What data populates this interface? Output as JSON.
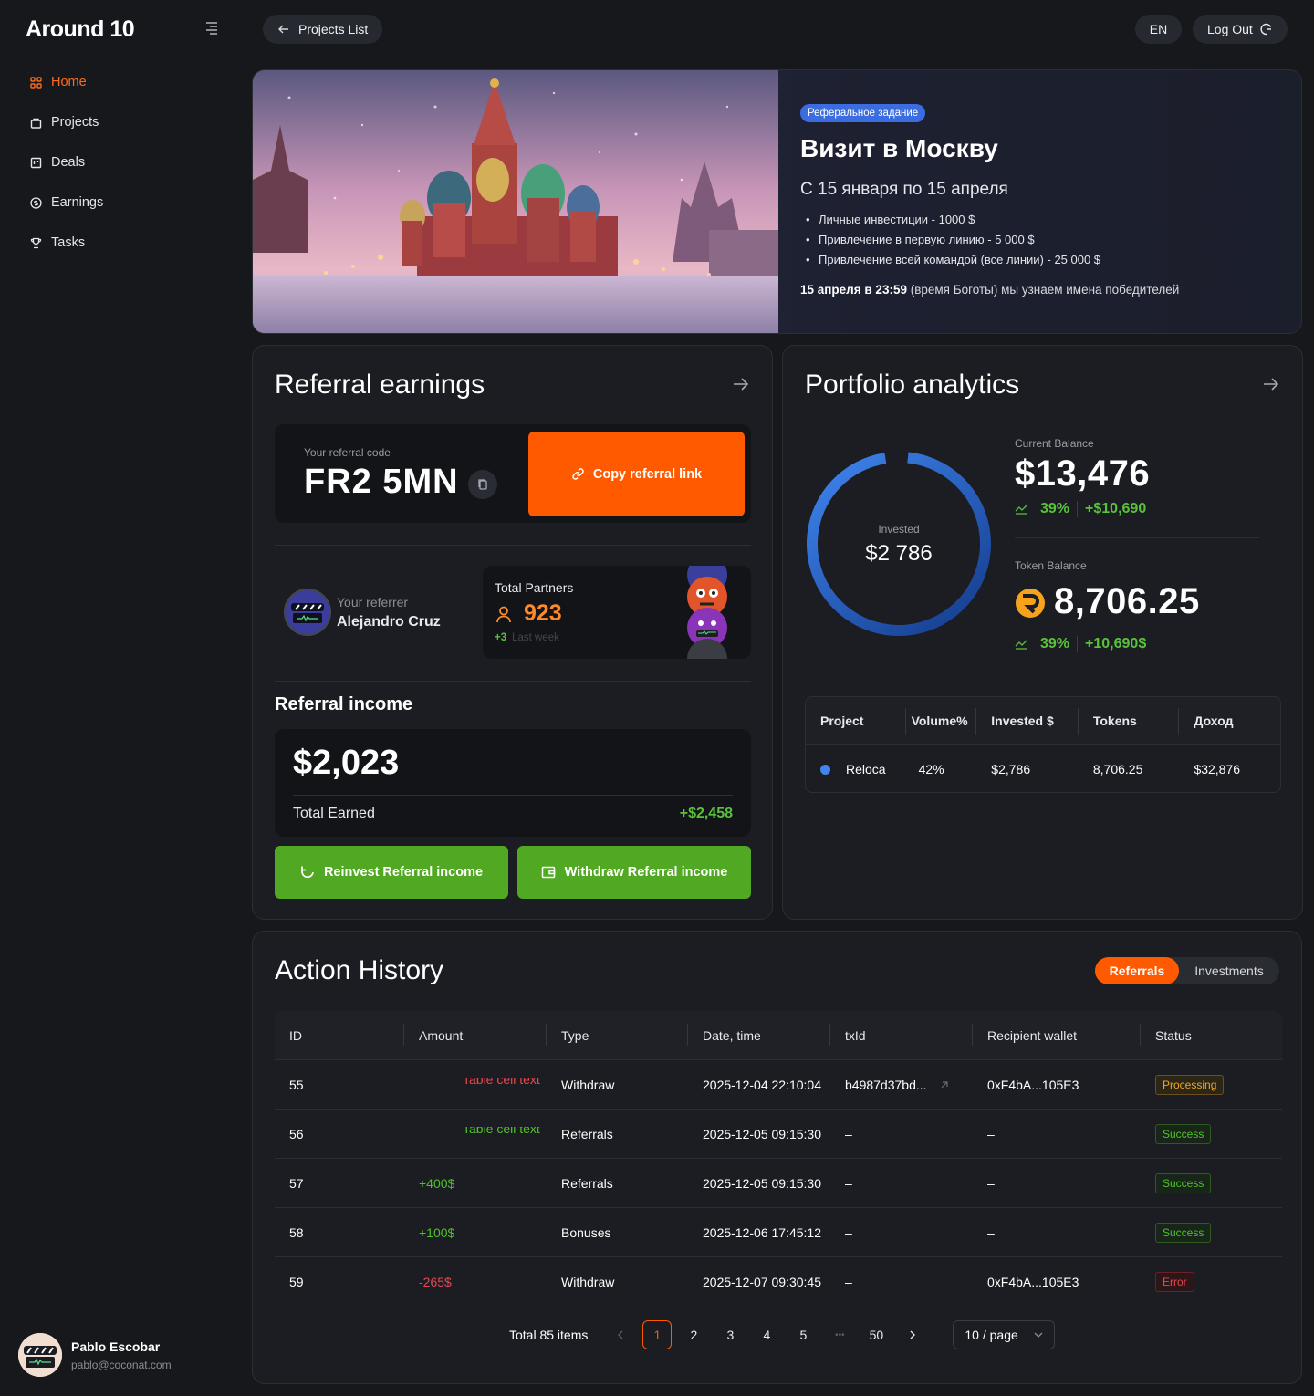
{
  "brand": {
    "logo": "Around 10"
  },
  "nav": [
    {
      "label": "Home",
      "icon": "grid-icon"
    },
    {
      "label": "Projects",
      "icon": "bag-icon"
    },
    {
      "label": "Deals",
      "icon": "board-icon"
    },
    {
      "label": "Earnings",
      "icon": "dollar-circle-icon"
    },
    {
      "label": "Tasks",
      "icon": "trophy-icon"
    }
  ],
  "user": {
    "name": "Pablo Escobar",
    "email": "pablo@coconat.com"
  },
  "topbar": {
    "back_label": "Projects List",
    "lang": "EN",
    "logout_label": "Log Out"
  },
  "banner": {
    "badge": "Реферальное задание",
    "title": "Визит в Москву",
    "subtitle": "С 15 января по 15 апреля",
    "items": [
      "Личные инвестиции - 1000 $",
      "Привлечение в первую линию - 5 000 $",
      "Привлечение всей командой (все линии) - 25 000 $"
    ],
    "note_bold": "15 апреля в 23:59",
    "note_rest": " (время Боготы) мы узнаем имена победителей"
  },
  "referral": {
    "title": "Referral earnings",
    "code_label": "Your referral code",
    "code": "FR2 5MN",
    "copy_link": "Copy referral link",
    "referrer_label": "Your referrer",
    "referrer_name": "Alejandro Cruz",
    "partners_label": "Total Partners",
    "partners_count": "923",
    "partners_delta": "+3",
    "partners_period": "Last week",
    "income_title": "Referral income",
    "income_value": "$2,023",
    "total_earned_label": "Total Earned",
    "total_earned_delta": "+$2,458",
    "reinvest_label": "Reinvest Referral income",
    "withdraw_label": "Withdraw Referral income"
  },
  "portfolio": {
    "title": "Portfolio analytics",
    "invested_label": "Invested",
    "invested_value": "$2 786",
    "current_balance_label": "Current Balance",
    "current_balance": "$13,476",
    "current_pct": "39%",
    "current_delta": "+$10,690",
    "token_balance_label": "Token Balance",
    "token_balance": "8,706.25",
    "token_pct": "39%",
    "token_delta": "+10,690$",
    "accent": "#2f6fe0",
    "table": {
      "headers": [
        "Project",
        "Volume%",
        "Invested $",
        "Tokens",
        "Доход"
      ],
      "rows": [
        [
          "Reloca",
          "42%",
          "$2,786",
          "8,706.25",
          "$32,876"
        ]
      ]
    }
  },
  "history": {
    "title": "Action History",
    "tabs": [
      "Referrals",
      "Investments"
    ],
    "headers": [
      "ID",
      "Amount",
      "Type",
      "Date, time",
      "txId",
      "Recipient wallet",
      "Status"
    ],
    "rows": [
      {
        "id": "55",
        "amount": "Table cell text",
        "amount_color": "#e5484d",
        "type": "Withdraw",
        "date": "2025-12-04 22:10:04",
        "txid": "b4987d37bd...",
        "wallet": "0xF4bA...105E3",
        "status": "Processing"
      },
      {
        "id": "56",
        "amount": "Table cell text",
        "amount_color": "#4fc02a",
        "type": "Referrals",
        "date": "2025-12-05 09:15:30",
        "txid": "–",
        "wallet": "–",
        "status": "Success"
      },
      {
        "id": "57",
        "amount": "+400$",
        "amount_color": "#4fc02a",
        "type": "Referrals",
        "date": "2025-12-05 09:15:30",
        "txid": "–",
        "wallet": "–",
        "status": "Success"
      },
      {
        "id": "58",
        "amount": "+100$",
        "amount_color": "#4fc02a",
        "type": "Bonuses",
        "date": "2025-12-06 17:45:12",
        "txid": "–",
        "wallet": "–",
        "status": "Success"
      },
      {
        "id": "59",
        "amount": "-265$",
        "amount_color": "#e5484d",
        "type": "Withdraw",
        "date": "2025-12-07 09:30:45",
        "txid": "–",
        "wallet": "0xF4bA...105E3",
        "status": "Error"
      }
    ],
    "pagination": {
      "total": "Total 85 items",
      "pages": [
        "1",
        "2",
        "3",
        "4",
        "5",
        "•••",
        "50"
      ],
      "page_size": "10 / page"
    }
  }
}
